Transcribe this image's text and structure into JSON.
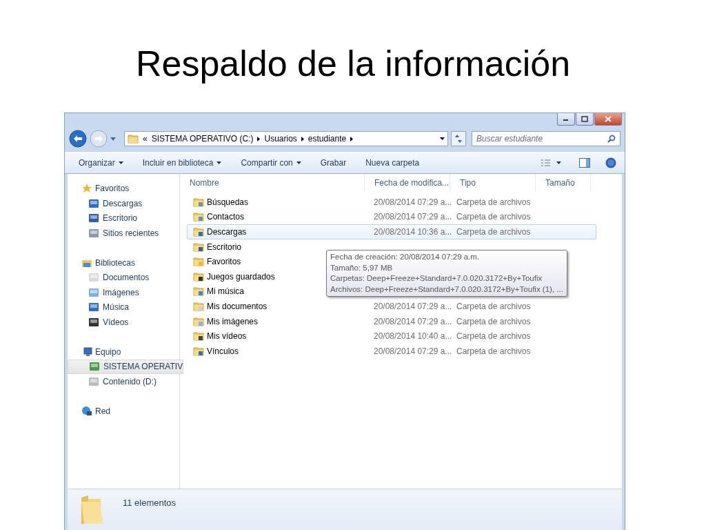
{
  "slide_title": "Respaldo de la información",
  "address_bar": {
    "overflow": "«",
    "crumbs": [
      "SISTEMA OPERATIVO (C:)",
      "Usuarios",
      "estudiante"
    ]
  },
  "search": {
    "placeholder": "Buscar estudiante"
  },
  "toolbar": [
    {
      "label": "Organizar",
      "has_menu": true
    },
    {
      "label": "Incluir en biblioteca",
      "has_menu": true
    },
    {
      "label": "Compartir con",
      "has_menu": true
    },
    {
      "label": "Grabar",
      "has_menu": false
    },
    {
      "label": "Nueva carpeta",
      "has_menu": false
    }
  ],
  "sidebar": [
    {
      "label": "Favoritos",
      "items": [
        {
          "label": "Descargas",
          "selected": false
        },
        {
          "label": "Escritorio",
          "selected": false
        },
        {
          "label": "Sitios recientes",
          "selected": false
        }
      ]
    },
    {
      "label": "Bibliotecas",
      "items": [
        {
          "label": "Documentos",
          "selected": false
        },
        {
          "label": "Imágenes",
          "selected": false
        },
        {
          "label": "Música",
          "selected": false
        },
        {
          "label": "Vídeos",
          "selected": false
        }
      ]
    },
    {
      "label": "Equipo",
      "items": [
        {
          "label": "SISTEMA OPERATIV",
          "selected": true
        },
        {
          "label": "Contenido (D:)",
          "selected": false
        }
      ]
    },
    {
      "label": "Red"
    }
  ],
  "table": {
    "columns": [
      "Nombre",
      "Fecha de modifica...",
      "Tipo",
      "Tamaño"
    ],
    "rows": [
      {
        "name": "Búsquedas",
        "date": "20/08/2014 07:29 a...",
        "type": "Carpeta de archivos",
        "selected": false
      },
      {
        "name": "Contactos",
        "date": "20/08/2014 07:29 a...",
        "type": "Carpeta de archivos",
        "selected": false
      },
      {
        "name": "Descargas",
        "date": "20/08/2014 10:36 a...",
        "type": "Carpeta de archivos",
        "selected": true
      },
      {
        "name": "Escritorio",
        "selected": false
      },
      {
        "name": "Favoritos",
        "selected": false
      },
      {
        "name": "Juegos guardados",
        "selected": false
      },
      {
        "name": "Mi música",
        "selected": false
      },
      {
        "name": "Mis documentos",
        "date": "20/08/2014 07:29 a...",
        "type": "Carpeta de archivos",
        "selected": false
      },
      {
        "name": "Mis imágenes",
        "date": "20/08/2014 07:29 a...",
        "type": "Carpeta de archivos",
        "selected": false
      },
      {
        "name": "Mis vídeos",
        "date": "20/08/2014 10:40 a...",
        "type": "Carpeta de archivos",
        "selected": false
      },
      {
        "name": "Vínculos",
        "date": "20/08/2014 07:29 a...",
        "type": "Carpeta de archivos",
        "selected": false
      }
    ]
  },
  "tooltip": [
    "Fecha de creación: 20/08/2014 07:29 a.m.",
    "Tamaño: 5,97 MB",
    "Carpetas: Deep+Freeze+Standard+7.0.020.3172+By+Toufix",
    "Archivos: Deep+Freeze+Standard+7.0.020.3172+By+Toufix (1), ..."
  ],
  "status_bar": {
    "count": "11 elementos"
  }
}
